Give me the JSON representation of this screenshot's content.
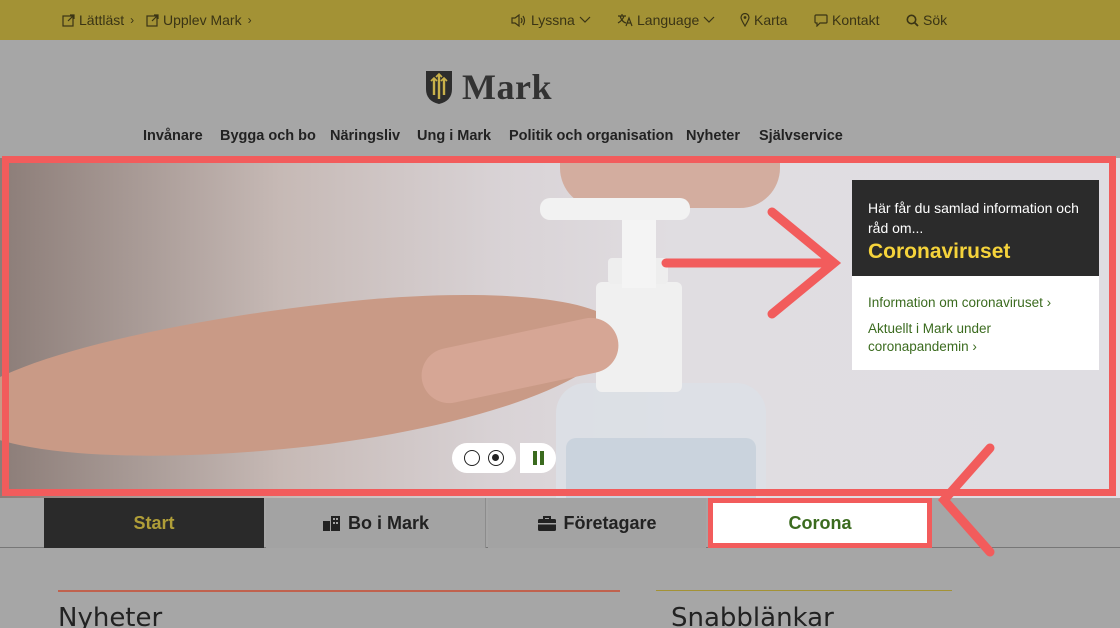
{
  "topbar": {
    "easy_read": "Lättläst",
    "experience": "Upplev Mark",
    "listen": "Lyssna",
    "language": "Language",
    "map": "Karta",
    "contact": "Kontakt",
    "search": "Sök"
  },
  "logo": {
    "text": "Mark"
  },
  "nav": [
    "Invånare",
    "Bygga och bo",
    "Näringsliv",
    "Ung i Mark",
    "Politik och organisation",
    "Nyheter",
    "Självservice"
  ],
  "hero": {
    "intro": "Här får du samlad information och råd om...",
    "headline": "Coronaviruset",
    "links": [
      "Information om coronaviruset",
      "Aktuellt i Mark under coronapandemin"
    ],
    "slides": 2,
    "active_slide": 2
  },
  "tabs": [
    "Start",
    "Bo i Mark",
    "Företagare",
    "Corona"
  ],
  "sections": {
    "news": "Nyheter",
    "quicklinks": "Snabblänkar"
  },
  "colors": {
    "topbar": "#a39235",
    "accent_green": "#3b6b1f",
    "highlight_yellow": "#f5d33b",
    "annotation_red": "#f25c5c"
  }
}
